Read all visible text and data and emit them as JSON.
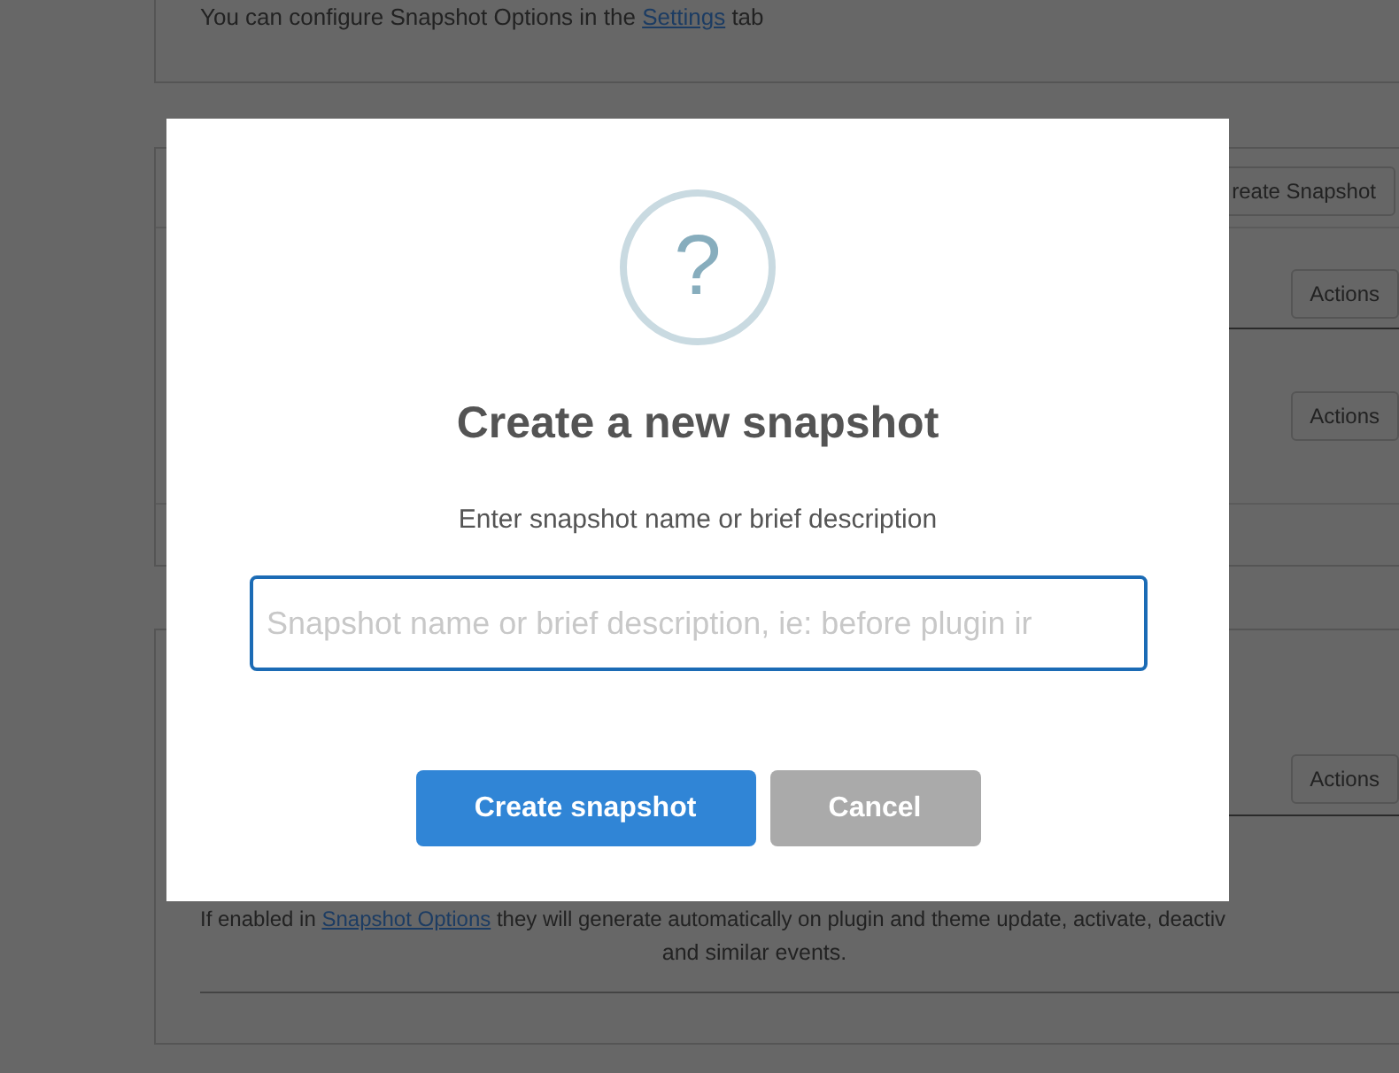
{
  "background": {
    "intro": {
      "text": "You can configure Snapshot Options in the ",
      "link": "Settings",
      "after": " tab"
    },
    "panel_1": {
      "header_button": "reate Snapshot",
      "actions": [
        "Actions",
        "Actions"
      ]
    },
    "panel_2": {
      "actions": [
        "Actions"
      ],
      "note_line_1": {
        "before": "If enabled in ",
        "link": "Snapshot Options",
        "after": " they will generate automatically on plugin and theme update, activate, deactiv"
      },
      "note_line_2": "and similar events."
    }
  },
  "dialog": {
    "icon": "?",
    "title": "Create a new snapshot",
    "message": "Enter snapshot name or brief description",
    "input": {
      "placeholder": "Snapshot name or brief description, ie: before plugin ir",
      "focused": true
    },
    "buttons": [
      {
        "label": "Create snapshot",
        "kind": "confirm"
      },
      {
        "label": "Cancel",
        "kind": "cancel"
      }
    ]
  }
}
